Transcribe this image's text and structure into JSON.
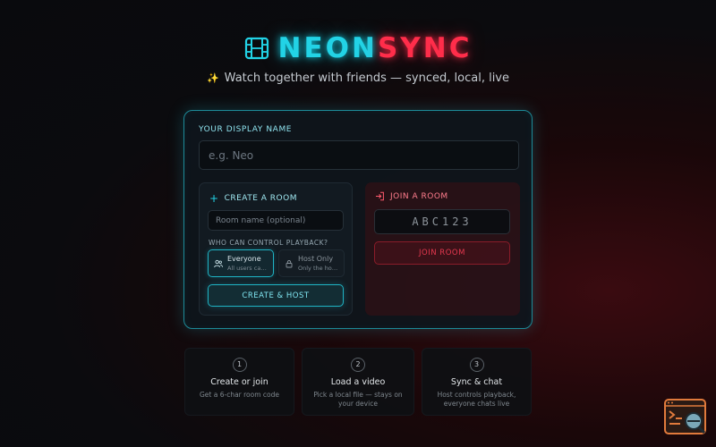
{
  "app": {
    "title_part1": "NEON",
    "title_part2": "SYNC",
    "tagline": "Watch together with friends — synced, local, live"
  },
  "form": {
    "display_name_label": "YOUR DISPLAY NAME",
    "display_name_placeholder": "e.g. Neo"
  },
  "create": {
    "title": "CREATE A ROOM",
    "room_name_placeholder": "Room name (optional)",
    "control_label": "WHO CAN CONTROL PLAYBACK?",
    "options": [
      {
        "title": "Everyone",
        "desc": "All users can control",
        "selected": true
      },
      {
        "title": "Host Only",
        "desc": "Only the host controls",
        "selected": false
      }
    ],
    "button_label": "CREATE & HOST"
  },
  "join": {
    "title": "JOIN A ROOM",
    "code_placeholder": "ABC123",
    "button_label": "JOIN ROOM"
  },
  "steps": [
    {
      "num": "1",
      "title": "Create or join",
      "desc": "Get a 6-char room code"
    },
    {
      "num": "2",
      "title": "Load a video",
      "desc": "Pick a local file — stays on your device"
    },
    {
      "num": "3",
      "title": "Sync & chat",
      "desc": "Host controls playback, everyone chats live"
    }
  ],
  "colors": {
    "accent_cyan": "#22d3e6",
    "accent_red": "#ff2d4a",
    "background": "#0b0b0e"
  },
  "icons": [
    "film-icon",
    "sparkle-icon",
    "plus-icon",
    "login-icon",
    "users-icon",
    "lock-icon",
    "console-search-icon"
  ]
}
